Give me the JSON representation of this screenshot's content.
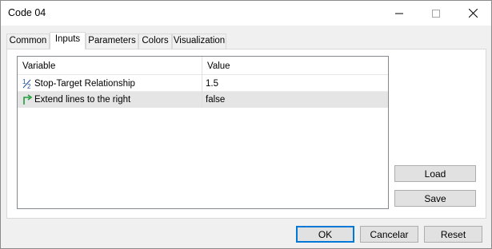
{
  "window": {
    "title": "Code 04"
  },
  "tabs": [
    {
      "label": "Common"
    },
    {
      "label": "Inputs"
    },
    {
      "label": "Parameters"
    },
    {
      "label": "Colors"
    },
    {
      "label": "Visualization"
    }
  ],
  "active_tab": "Inputs",
  "grid": {
    "columns": [
      "Variable",
      "Value"
    ],
    "rows": [
      {
        "icon": "fraction-icon",
        "variable": "Stop-Target Relationship",
        "value": "1.5"
      },
      {
        "icon": "bool-arrow-icon",
        "variable": "Extend lines to the right",
        "value": "false"
      }
    ]
  },
  "side_buttons": {
    "load": "Load",
    "save": "Save"
  },
  "footer_buttons": {
    "ok": "OK",
    "cancel": "Cancelar",
    "reset": "Reset"
  },
  "colors": {
    "accent": "#0078d7",
    "selected_row": "#e5e5e5",
    "bool_icon": "#1e9e3a"
  }
}
